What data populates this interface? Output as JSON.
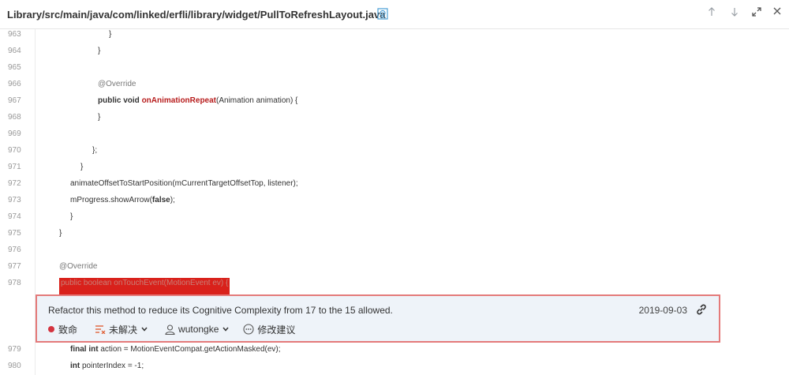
{
  "header": {
    "file_path": "Library/src/main/java/com/linked/erfli/library/widget/PullToRefreshLayout.java",
    "buttons": [
      "up-arrow",
      "down-arrow",
      "expand",
      "close"
    ]
  },
  "colors": {
    "highlight": "#d9211b",
    "issue_border": "#e47a7a",
    "issue_bg": "#eef3f9",
    "severity": "#d4333f",
    "method_name": "#b71c1c"
  },
  "code_lines": [
    {
      "num": "963",
      "indent": 138,
      "text": "}"
    },
    {
      "num": "964",
      "indent": 124,
      "text": "}"
    },
    {
      "num": "965",
      "indent": 0,
      "text": ""
    },
    {
      "num": "966",
      "indent": 124,
      "text": "@Override"
    },
    {
      "num": "967",
      "indent": 124,
      "text": "public void onAnimationRepeat(Animation animation) {"
    },
    {
      "num": "968",
      "indent": 124,
      "text": "}"
    },
    {
      "num": "969",
      "indent": 0,
      "text": ""
    },
    {
      "num": "970",
      "indent": 117,
      "text": "};"
    },
    {
      "num": "971",
      "indent": 102,
      "text": "}"
    },
    {
      "num": "972",
      "indent": 89,
      "text": "animateOffsetToStartPosition(mCurrentTargetOffsetTop, listener);"
    },
    {
      "num": "973",
      "indent": 89,
      "text": "mProgress.showArrow(false);"
    },
    {
      "num": "974",
      "indent": 89,
      "text": "}"
    },
    {
      "num": "975",
      "indent": 75,
      "text": "}"
    },
    {
      "num": "976",
      "indent": 0,
      "text": ""
    },
    {
      "num": "977",
      "indent": 75,
      "text": "@Override"
    },
    {
      "num": "978",
      "indent": 75,
      "text": "public boolean onTouchEvent(MotionEvent ev) {"
    },
    {
      "num": "979",
      "indent": 89,
      "text": "final int action = MotionEventCompat.getActionMasked(ev);"
    },
    {
      "num": "980",
      "indent": 89,
      "text": "int pointerIndex = -1;"
    }
  ],
  "code": {
    "l966": "@Override",
    "l967_kw": "public void ",
    "l967_fn": "onAnimationRepeat",
    "l967_rest": "(Animation animation) {",
    "l972": "animateOffsetToStartPosition(mCurrentTargetOffsetTop, listener);",
    "l973_a": "mProgress.showArrow(",
    "l973_kw": "false",
    "l973_b": ");",
    "l977": "@Override",
    "l978": "public boolean onTouchEvent(MotionEvent ev) {",
    "l979_kw": "final int",
    "l979_rest": " action = MotionEventCompat.getActionMasked(ev);",
    "l980_kw": "int",
    "l980_rest": " pointerIndex = -1;"
  },
  "issue": {
    "message": "Refactor this method to reduce its Cognitive Complexity from 17 to the 15 allowed.",
    "date": "2019-09-03",
    "severity": "致命",
    "status": "未解决",
    "assignee": "wutongke",
    "suggest": "修改建议"
  }
}
